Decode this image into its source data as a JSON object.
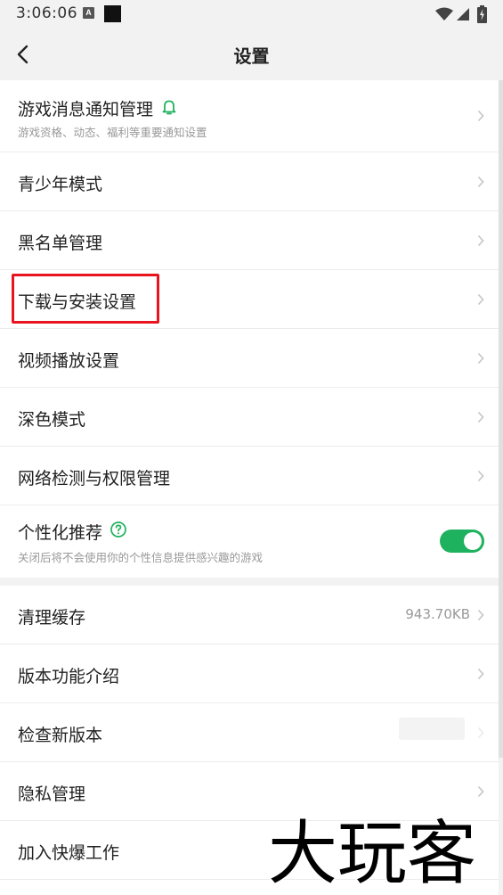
{
  "status_bar": {
    "time": "3:06:06",
    "notification_letter": "A",
    "icons": [
      "wifi-icon",
      "signal-icon",
      "battery-charging-icon"
    ]
  },
  "header": {
    "title": "设置",
    "back_icon": "chevron-left-icon"
  },
  "section1": [
    {
      "title": "游戏消息通知管理",
      "subtitle": "游戏资格、动态、福利等重要通知设置",
      "icon": "bell-icon",
      "accessory": "chevron"
    },
    {
      "title": "青少年模式",
      "accessory": "chevron"
    },
    {
      "title": "黑名单管理",
      "accessory": "chevron"
    },
    {
      "title": "下载与安装设置",
      "accessory": "chevron",
      "highlighted": true
    },
    {
      "title": "视频播放设置",
      "accessory": "chevron"
    },
    {
      "title": "深色模式",
      "accessory": "chevron"
    },
    {
      "title": "网络检测与权限管理",
      "accessory": "chevron"
    },
    {
      "title": "个性化推荐",
      "subtitle": "关闭后将不会使用你的个性信息提供感兴趣的游戏",
      "icon": "question-circle-icon",
      "accessory": "toggle",
      "toggle_on": true
    }
  ],
  "section2": [
    {
      "title": "清理缓存",
      "value": "943.70KB",
      "accessory": "chevron"
    },
    {
      "title": "版本功能介绍",
      "accessory": "chevron"
    },
    {
      "title": "检查新版本",
      "accessory": "chevron"
    },
    {
      "title": "隐私管理",
      "accessory": "chevron"
    },
    {
      "title": "加入快爆工作",
      "accessory": "chevron"
    }
  ],
  "watermark": "大玩客",
  "colors": {
    "accent_green": "#1fb25e",
    "highlight_red": "#e8141e",
    "background": "#f2f2f2"
  }
}
